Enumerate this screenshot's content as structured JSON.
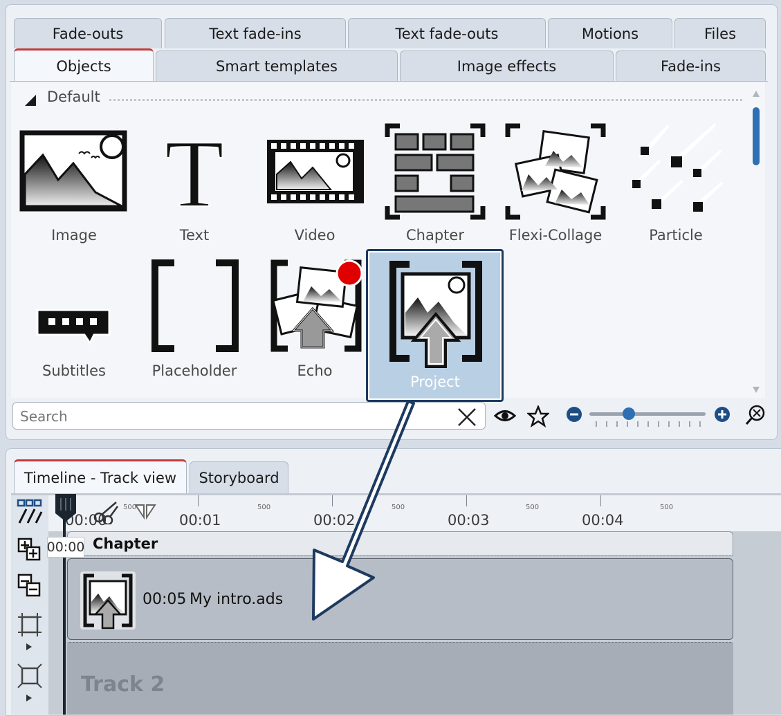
{
  "tabs_row1": [
    "Fade-outs",
    "Text fade-ins",
    "Text fade-outs",
    "Motions",
    "Files"
  ],
  "tabs_row2": [
    "Objects",
    "Smart templates",
    "Image effects",
    "Fade-ins"
  ],
  "active_tab": "Objects",
  "group_label": "Default",
  "objects": [
    {
      "label": "Image",
      "icon": "image-icon"
    },
    {
      "label": "Text",
      "icon": "text-icon"
    },
    {
      "label": "Video",
      "icon": "video-icon"
    },
    {
      "label": "Chapter",
      "icon": "chapter-icon"
    },
    {
      "label": "Flexi-Collage",
      "icon": "flexi-collage-icon"
    },
    {
      "label": "Particle",
      "icon": "particle-icon"
    },
    {
      "label": "Subtitles",
      "icon": "subtitles-icon"
    },
    {
      "label": "Placeholder",
      "icon": "placeholder-icon"
    },
    {
      "label": "Echo",
      "icon": "echo-icon"
    },
    {
      "label": "Project",
      "icon": "project-icon"
    }
  ],
  "search": {
    "placeholder": "Search",
    "value": ""
  },
  "bottom_tabs": [
    "Timeline - Track view",
    "Storyboard"
  ],
  "ruler": {
    "labels": [
      "00:00",
      "00:01",
      "00:02",
      "00:03",
      "00:04"
    ],
    "half_labels": [
      "500",
      "500",
      "500",
      "500",
      "500"
    ]
  },
  "playhead_time": "00:00",
  "chapter_label": "Chapter",
  "clip": {
    "duration": "00:05",
    "name": "My intro.ads"
  },
  "track2_label": "Track 2",
  "colors": {
    "accent_blue": "#2f6fb3",
    "tab_active_line": "#c23a3a",
    "record_dot": "#e00000",
    "highlight_border": "#1d3a5f"
  }
}
